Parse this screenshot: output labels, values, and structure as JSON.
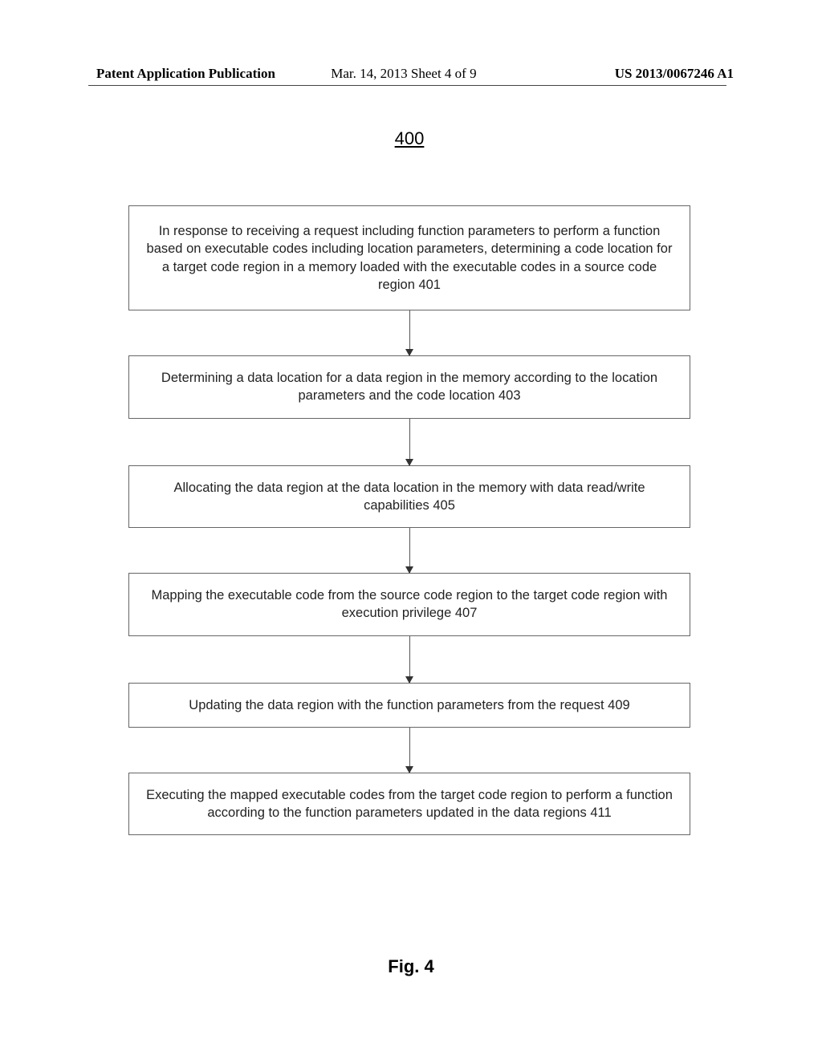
{
  "header": {
    "left": "Patent Application Publication",
    "center": "Mar. 14, 2013  Sheet 4 of 9",
    "right": "US 2013/0067246 A1"
  },
  "figure_number": "400",
  "figure_caption": "Fig. 4",
  "chart_data": {
    "type": "flowchart",
    "direction": "top-to-bottom",
    "nodes": [
      {
        "id": "401",
        "text": "In response to receiving a request including function parameters to perform a function based on executable codes including location parameters, determining a code location for a target code region in a memory loaded with the executable codes in a source code region 401"
      },
      {
        "id": "403",
        "text": "Determining a data location for a data region in the memory according to the location parameters and the code location 403"
      },
      {
        "id": "405",
        "text": "Allocating the data region at the data location in the memory with data read/write capabilities 405"
      },
      {
        "id": "407",
        "text": "Mapping the executable code from the source code region to the target code region with execution privilege 407"
      },
      {
        "id": "409",
        "text": "Updating the data region with the function parameters from the request  409"
      },
      {
        "id": "411",
        "text": "Executing the mapped executable codes from the target code region to perform a function according to the function parameters updated in the data regions 411"
      }
    ],
    "edges": [
      {
        "from": "401",
        "to": "403"
      },
      {
        "from": "403",
        "to": "405"
      },
      {
        "from": "405",
        "to": "407"
      },
      {
        "from": "407",
        "to": "409"
      },
      {
        "from": "409",
        "to": "411"
      }
    ]
  }
}
